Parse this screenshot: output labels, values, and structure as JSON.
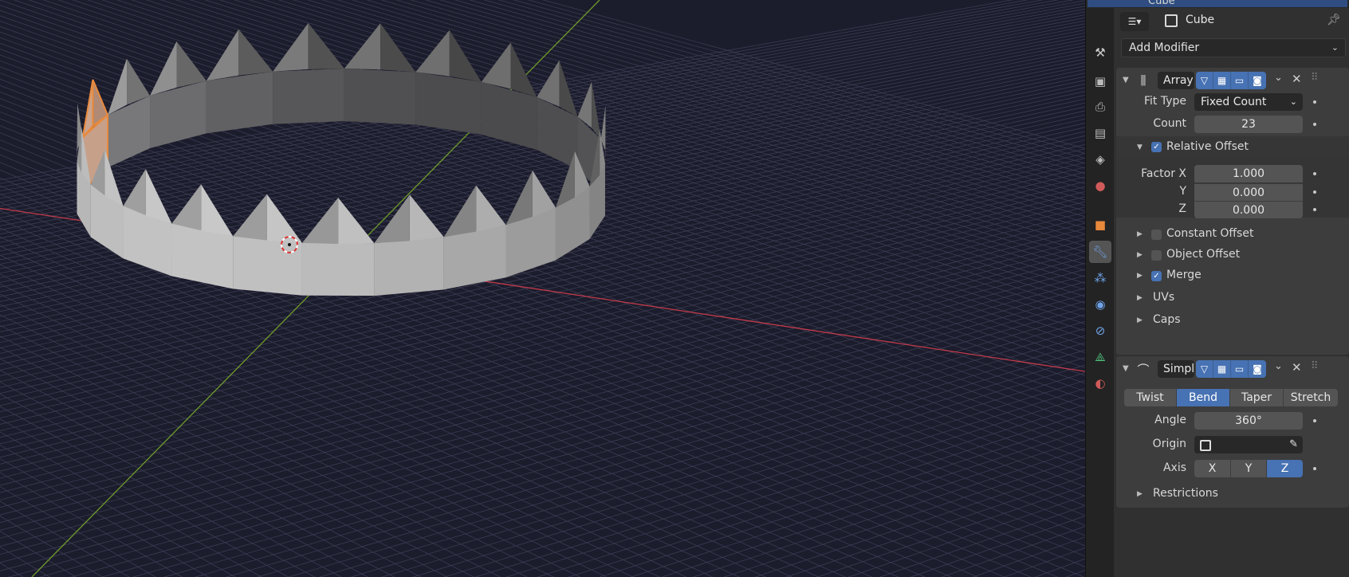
{
  "outliner": {
    "row_text": "Cube"
  },
  "header": {
    "object_name": "Cube",
    "editor_type_icon": "properties-editor-icon"
  },
  "add_modifier": {
    "label": "Add Modifier"
  },
  "tabs": [
    "tool-icon",
    "render-icon",
    "output-icon",
    "view-layer-icon",
    "scene-icon",
    "world-icon",
    "object-icon",
    "modifier-icon",
    "particles-icon",
    "physics-icon",
    "constraints-icon",
    "data-icon",
    "material-icon"
  ],
  "active_tab": "modifier-icon",
  "array": {
    "name": "Array",
    "fit_type_label": "Fit Type",
    "fit_type_value": "Fixed Count",
    "count_label": "Count",
    "count_value": "23",
    "relative_offset": {
      "label": "Relative Offset",
      "checked": true
    },
    "factor_x_label": "Factor X",
    "factor_x_value": "1.000",
    "y_label": "Y",
    "y_value": "0.000",
    "z_label": "Z",
    "z_value": "0.000",
    "constant_offset": {
      "label": "Constant Offset",
      "checked": false
    },
    "object_offset": {
      "label": "Object Offset",
      "checked": false
    },
    "merge": {
      "label": "Merge",
      "checked": true
    },
    "uvs_label": "UVs",
    "caps_label": "Caps"
  },
  "simple_deform": {
    "name": "Simpl",
    "modes": [
      "Twist",
      "Bend",
      "Taper",
      "Stretch"
    ],
    "active_mode": "Bend",
    "angle_label": "Angle",
    "angle_value": "360°",
    "origin_label": "Origin",
    "axis_label": "Axis",
    "axes": [
      "X",
      "Y",
      "Z"
    ],
    "active_axis": "Z",
    "restrictions_label": "Restrictions"
  },
  "colors": {
    "accent": "#4772b3",
    "selection_orange": "#e8893c",
    "x_axis": "#c33a4a",
    "y_axis": "#6e9b2a",
    "viewport_bg": "#1b1c2c"
  }
}
